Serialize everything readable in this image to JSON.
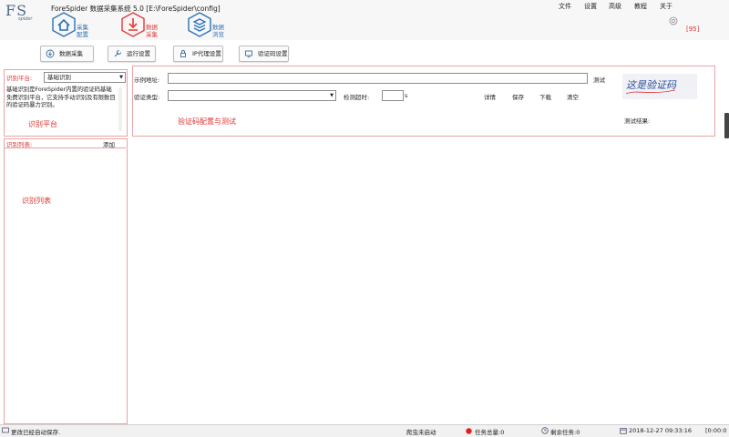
{
  "app": {
    "title": "ForeSpider 数据采集系统  5.0  [E:\\ForeSpider\\config]",
    "logo_text": "FS",
    "logo_sub": "spider"
  },
  "nav": [
    {
      "label_line1": "采集",
      "label_line2": "配置",
      "icon": "house-icon",
      "color": "#2e6fb0"
    },
    {
      "label_line1": "数据",
      "label_line2": "采集",
      "icon": "download-icon",
      "color": "#e03a3a"
    },
    {
      "label_line1": "数据",
      "label_line2": "浏览",
      "icon": "layers-icon",
      "color": "#2e6fb0"
    }
  ],
  "menu": [
    "文件",
    "设置",
    "高级",
    "教程",
    "关于"
  ],
  "page_indicator": "[95]",
  "toolbar": {
    "collect": "数据采集",
    "run_settings": "运行设置",
    "ip_proxy": "IP代理设置",
    "captcha_settings": "验证码设置"
  },
  "platform": {
    "label": "识别平台:",
    "selected": "基础识别",
    "description": "基础识别是ForeSpider内置的验证码基础免费识别平台，它支持手动识别及有限数目的验证码暴力识别。",
    "annotation": "识别平台"
  },
  "config": {
    "example_url_label": "示例地址:",
    "example_url_value": "",
    "test_button": "测试",
    "captcha_type_label": "验证类型:",
    "captcha_type_value": "",
    "timeout_label": "检测超时:",
    "timeout_value": "",
    "timeout_unit": "s",
    "details": "详情",
    "save": "保存",
    "download": "下载",
    "clear": "清空",
    "annotation": "验证码配置与测试",
    "captcha_image_text": "这是验证码",
    "test_result_label": "测试结果:"
  },
  "list": {
    "label": "识别列表:",
    "add": "添加",
    "annotation": "识别列表"
  },
  "status": {
    "message": "更改已经自动保存.",
    "crawler_state": "爬虫未启动",
    "task_total": "任务总量:0",
    "task_remaining": "剩余任务:0",
    "datetime": "2018-12-27  09:33:16",
    "elapsed": "[0:00:0"
  },
  "colors": {
    "accent_red": "#d33333",
    "nav_blue": "#2e6fb0",
    "panel_border": "#e8a3a3"
  }
}
